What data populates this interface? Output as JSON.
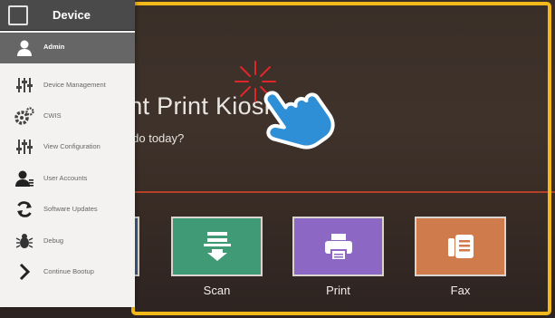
{
  "device_menu": {
    "title": "Device",
    "header_icon": "device-frame-icon",
    "items": [
      {
        "label": "Admin",
        "icon": "user-icon",
        "active": true
      },
      {
        "label": "Device Management",
        "icon": "sliders-icon"
      },
      {
        "label": "CWIS",
        "icon": "gears-icon"
      },
      {
        "label": "View Configuration",
        "icon": "sliders-icon"
      },
      {
        "label": "User Accounts",
        "icon": "user-accounts-icon"
      },
      {
        "label": "Software Updates",
        "icon": "refresh-icon"
      },
      {
        "label": "Debug",
        "icon": "bug-icon"
      },
      {
        "label": "Continue Bootup",
        "icon": "chevron-right-icon"
      }
    ]
  },
  "kiosk": {
    "title": "nstant Print Kiosk",
    "subtitle": "ant to do today?",
    "tiles": [
      {
        "label": "Scan",
        "icon": "scan-icon",
        "color": "#3f9a75"
      },
      {
        "label": "Print",
        "icon": "printer-icon",
        "color": "#8c68c4"
      },
      {
        "label": "Fax",
        "icon": "fax-icon",
        "color": "#d07b4c"
      }
    ],
    "partial_tile_color": "#3e5e82",
    "divider_color": "#b4402a"
  },
  "annotation": {
    "highlight_color": "#f3b81a",
    "gesture": "tap-hand-icon",
    "hand_color": "#2f8fd6",
    "burst_color": "#e0262b"
  }
}
